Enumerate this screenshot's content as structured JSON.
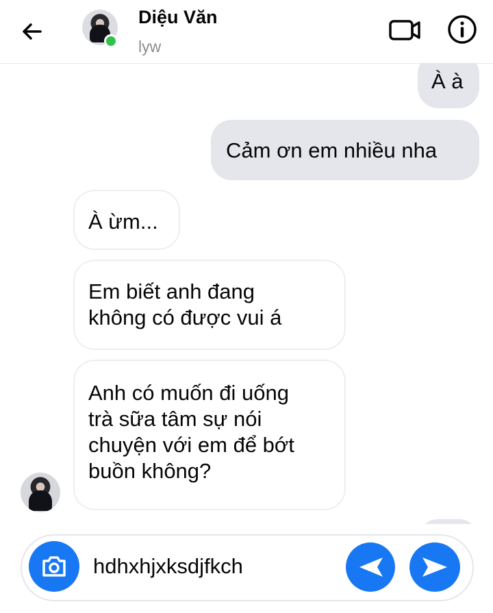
{
  "header": {
    "contact_name": "Diệu Văn",
    "contact_status": "lyw",
    "icons": [
      "back-arrow-icon",
      "video-call-icon",
      "info-icon"
    ]
  },
  "messages": [
    {
      "direction": "outgoing",
      "text": "À à"
    },
    {
      "direction": "outgoing",
      "text": "Cảm ơn em nhiều nha"
    },
    {
      "direction": "incoming",
      "text": "À ừm..."
    },
    {
      "direction": "incoming",
      "lines": [
        "Em biết anh đang",
        "không có được vui á"
      ]
    },
    {
      "direction": "incoming",
      "lines": [
        "Anh có muốn đi uống",
        "trà sữa tâm sự nói",
        "chuyện với em để bớt",
        "buồn không?"
      ]
    }
  ],
  "composer": {
    "draft_text": "hdhxhjxksdjfkch",
    "icons": [
      "camera-icon",
      "reply-arrow-icon",
      "send-icon"
    ]
  },
  "colors": {
    "accent": "#1877f2",
    "outgoing_bubble": "#e4e6eb",
    "online": "#31c24d"
  }
}
